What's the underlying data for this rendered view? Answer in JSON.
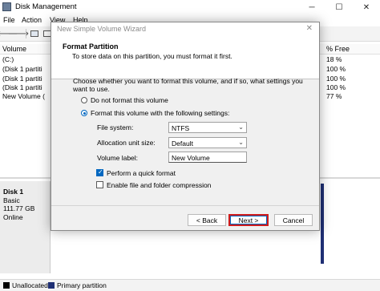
{
  "disk_management": {
    "title": "Disk Management",
    "window_controls": [
      "─",
      "☐",
      "✕"
    ],
    "menu": [
      "File",
      "Action",
      "View",
      "Help"
    ],
    "volume_columns": [
      "Volume",
      "% Free"
    ],
    "volumes": [
      {
        "name": "(C:)",
        "free": "18 %"
      },
      {
        "name": "(Disk 1 partiti",
        "free": "100 %"
      },
      {
        "name": "(Disk 1 partiti",
        "free": "100 %"
      },
      {
        "name": "(Disk 1 partiti",
        "free": "100 %"
      },
      {
        "name": "New Volume (",
        "free": "77 %"
      }
    ],
    "disk": {
      "name": "Disk 1",
      "type": "Basic",
      "size": "111.77 GB",
      "status": "Online"
    },
    "legend": [
      {
        "label": "Unallocated",
        "color": "#000000"
      },
      {
        "label": "Primary partition",
        "color": "#1f2f74"
      }
    ]
  },
  "wizard": {
    "title": "New Simple Volume Wizard",
    "close_glyph": "✕",
    "header_title": "Format Partition",
    "header_subtitle": "To store data on this partition, you must format it first.",
    "question": "Choose whether you want to format this volume, and if so, what settings you want to use.",
    "option_no_format": "Do not format this volume",
    "option_format": "Format this volume with the following settings:",
    "file_system_label": "File system:",
    "file_system_value": "NTFS",
    "allocation_label": "Allocation unit size:",
    "allocation_value": "Default",
    "volume_label_label": "Volume label:",
    "volume_label_value": "New Volume",
    "quick_format_label": "Perform a quick format",
    "quick_format_checked": true,
    "compression_label": "Enable file and folder compression",
    "compression_checked": false,
    "back_button": "< Back",
    "next_button": "Next >",
    "cancel_button": "Cancel",
    "highlight_color": "#d01c1c",
    "accent_color": "#0067c0"
  }
}
